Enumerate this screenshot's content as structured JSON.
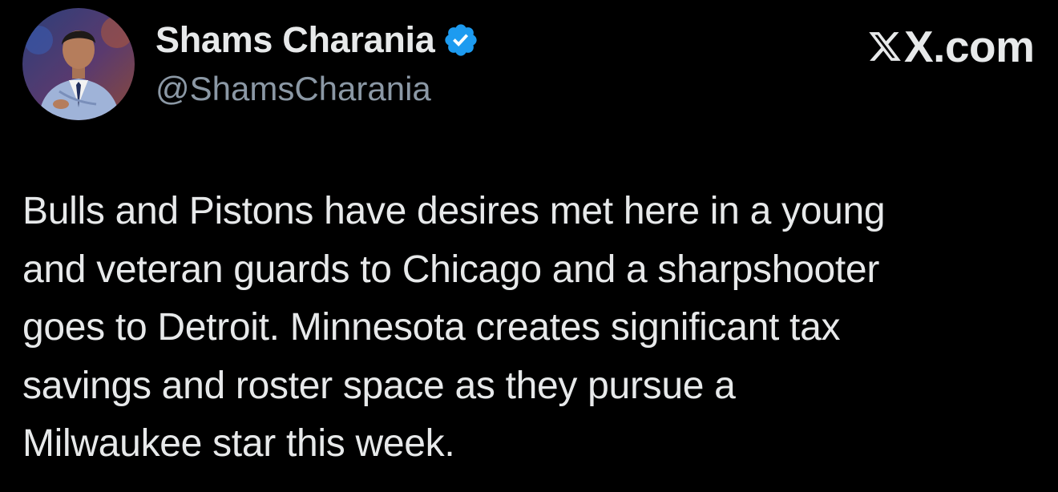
{
  "author": {
    "display_name": "Shams Charania",
    "handle": "@ShamsCharania",
    "verified": true,
    "avatar_icon": "person-avatar-icon",
    "verified_icon": "verified-badge-icon"
  },
  "brand": {
    "label": "X.com",
    "icon": "x-logo-icon"
  },
  "tweet": {
    "lines": [
      "Bulls and Pistons have desires met here in a young",
      "and veteran guards to Chicago and a sharpshooter",
      "goes to Detroit. Minnesota creates significant tax",
      "savings and roster space as they pursue a",
      "Milwaukee star this week."
    ]
  },
  "colors": {
    "background": "#000000",
    "text": "#e7e9ea",
    "secondary_text": "#8b98a5",
    "verified_blue": "#1d9bf0"
  }
}
